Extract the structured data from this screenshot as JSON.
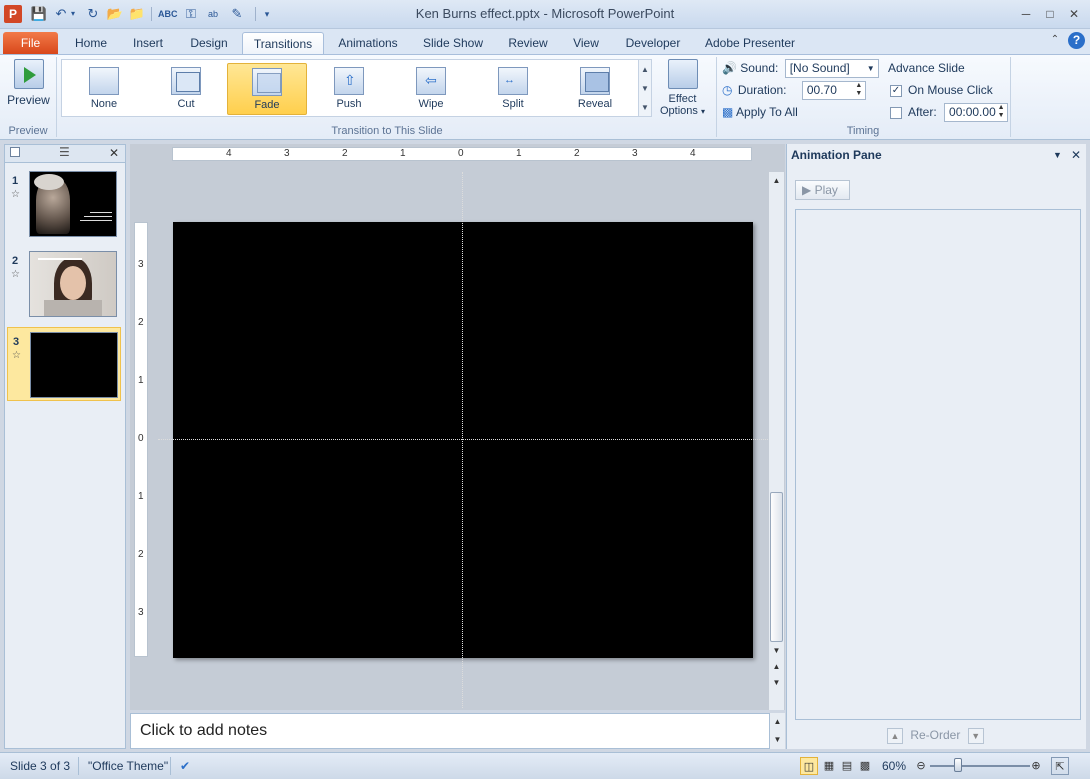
{
  "window": {
    "title": "Ken Burns effect.pptx - Microsoft PowerPoint",
    "app_icon_letter": "P"
  },
  "tabs": [
    {
      "label": "File"
    },
    {
      "label": "Home"
    },
    {
      "label": "Insert"
    },
    {
      "label": "Design"
    },
    {
      "label": "Transitions"
    },
    {
      "label": "Animations"
    },
    {
      "label": "Slide Show"
    },
    {
      "label": "Review"
    },
    {
      "label": "View"
    },
    {
      "label": "Developer"
    },
    {
      "label": "Adobe Presenter"
    }
  ],
  "active_tab": "Transitions",
  "ribbon": {
    "preview": {
      "button_label": "Preview",
      "group_label": "Preview"
    },
    "transition_group_label": "Transition to This Slide",
    "transitions": [
      {
        "label": "None"
      },
      {
        "label": "Cut"
      },
      {
        "label": "Fade",
        "selected": true
      },
      {
        "label": "Push"
      },
      {
        "label": "Wipe"
      },
      {
        "label": "Split"
      },
      {
        "label": "Reveal"
      }
    ],
    "effect_options_line1": "Effect",
    "effect_options_line2": "Options",
    "timing": {
      "group_label": "Timing",
      "sound_label": "Sound:",
      "sound_value": "[No Sound]",
      "duration_label": "Duration:",
      "duration_value": "00.70",
      "apply_all_label": "Apply To All",
      "advance_label": "Advance Slide",
      "on_mouse_click_label": "On Mouse Click",
      "on_mouse_click_checked": true,
      "after_label": "After:",
      "after_checked": false,
      "after_value": "00:00.00"
    }
  },
  "slides": [
    {
      "number": "1",
      "kind": "photo-elderly"
    },
    {
      "number": "2",
      "kind": "photo-woman"
    },
    {
      "number": "3",
      "kind": "black",
      "current": true
    }
  ],
  "ruler": {
    "horizontal": [
      "4",
      "3",
      "2",
      "1",
      "0",
      "1",
      "2",
      "3",
      "4"
    ],
    "vertical": [
      "3",
      "2",
      "1",
      "0",
      "1",
      "2",
      "3"
    ]
  },
  "notes_placeholder": "Click to add notes",
  "animation_pane": {
    "title": "Animation Pane",
    "play_label": "Play",
    "reorder_label": "Re-Order"
  },
  "status": {
    "slide_info": "Slide 3 of 3",
    "theme": "\"Office Theme\"",
    "zoom": "60%"
  },
  "colors": {
    "accent": "#d24726",
    "selected_gallery": "#ffd965",
    "slide_background": "#000000"
  }
}
